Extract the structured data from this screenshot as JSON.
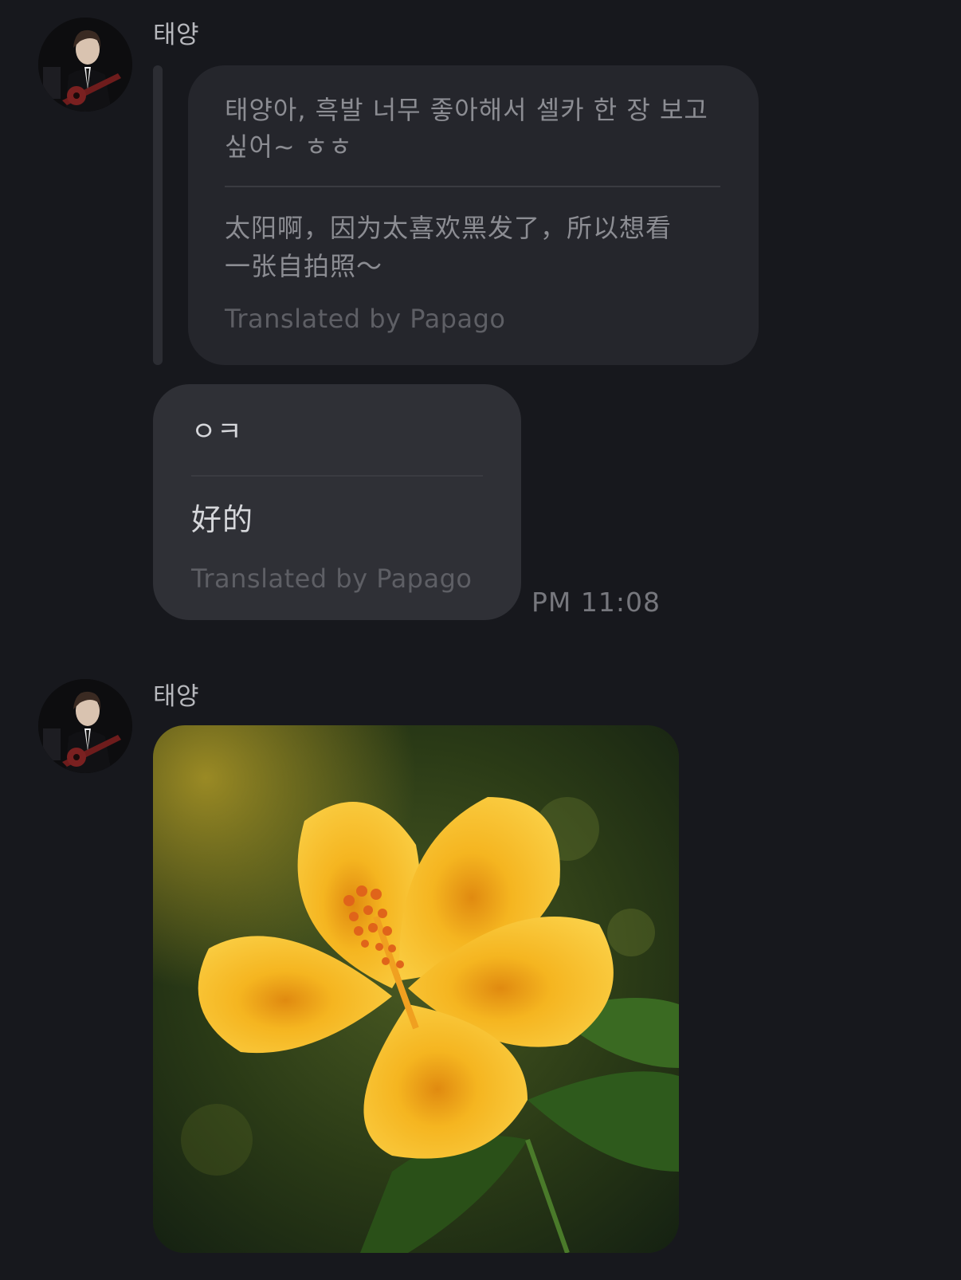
{
  "messages": {
    "group1": {
      "sender": "태양",
      "quoted": {
        "original": "태양아, 흑발 너무 좋아해서 셀카 한 장 보고 싶어~ ㅎㅎ",
        "original_line1": "태양아, 흑발 너무 좋아해서 셀카 한 장 보고",
        "original_line2": "싶어~ ㅎㅎ",
        "translation_line1": "太阳啊，因为太喜欢黑发了，所以想看",
        "translation_line2": "一张自拍照～",
        "translated_by": "Translated by Papago"
      },
      "reply": {
        "original": "ㅇㅋ",
        "translation": "好的",
        "translated_by": "Translated by Papago"
      },
      "time": "PM 11:08"
    },
    "group2": {
      "sender": "태양",
      "photo_icon": "image-photo"
    }
  },
  "colors": {
    "background": "#17181d",
    "bubble": "#2b2c32",
    "flower": "#f3b21f"
  }
}
